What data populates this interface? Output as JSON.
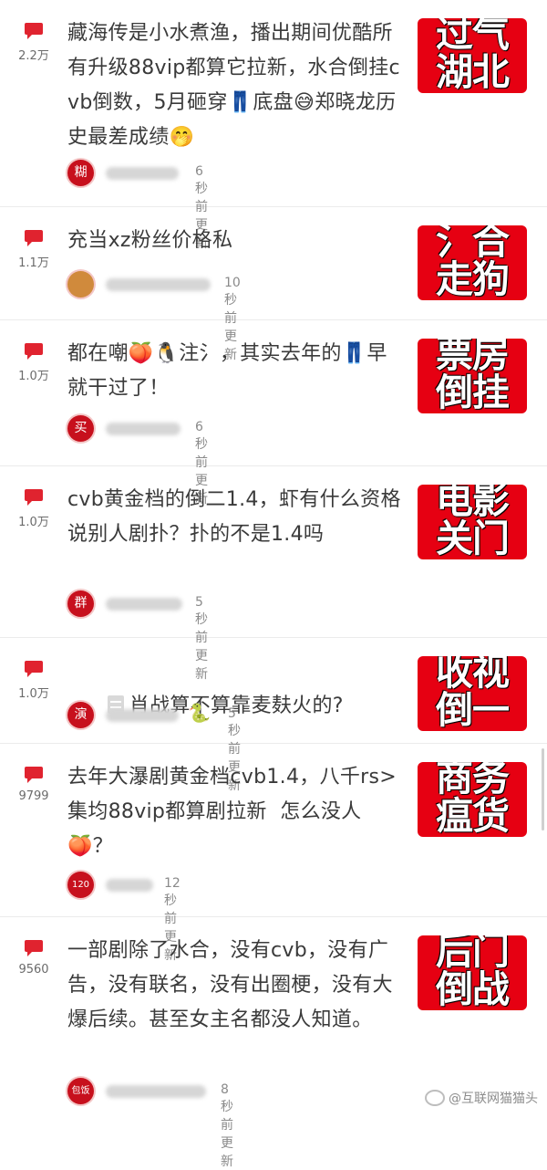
{
  "items": [
    {
      "count": "2.2万",
      "title": "藏海传是小水煮渔，播出期间优酷所有升级88vip都算它拉新，水合倒挂cvb倒数，5月砸穿👖底盘😅郑晓龙历史最差成绩🤭",
      "avatar": "糊",
      "time": "6秒前更新",
      "thumb": [
        "过气",
        "湖北"
      ]
    },
    {
      "count": "1.1万",
      "title": "充当xz粉丝价格私",
      "avatar": "",
      "time": "10秒前更新",
      "thumb": [
        "氵合",
        "走狗"
      ]
    },
    {
      "count": "1.0万",
      "title": "都在嘲🍑🐧注氵，其实去年的👖早就干过了！",
      "avatar": "买",
      "time": "6秒前更新",
      "thumb": [
        "票房",
        "倒挂"
      ]
    },
    {
      "count": "1.0万",
      "title": "cvb黄金档的倒二1.4，虾有什么资格说别人剧扑？扑的不是1.4吗",
      "avatar": "群",
      "time": "5秒前更新",
      "thumb": [
        "电影",
        "关门"
      ]
    },
    {
      "count": "1.0万",
      "title": "肖战算不算靠麦麸火的?",
      "avatar": "演",
      "badge": "🐍",
      "time": "5秒前更新",
      "thumb": [
        "收视",
        "倒一"
      ]
    },
    {
      "count": "9799",
      "title": "去年大瀑剧黄金档cvb1.4，八千rs>集均88vip都算剧拉新  怎么没人🍑？",
      "avatar": "120",
      "time": "12秒前更新",
      "thumb": [
        "商务",
        "瘟货"
      ]
    },
    {
      "count": "9560",
      "title": "一部剧除了水合，没有cvb，没有广告，没有联名，没有出圈梗，没有大爆后续。甚至女主名都没人知道。",
      "avatar": "包饭",
      "time": "8秒前更新",
      "thumb": [
        "后门",
        "倒战"
      ]
    }
  ],
  "watermark": "@互联网猫猫头",
  "colors": {
    "accent": "#e60012",
    "icon": "#e0232f",
    "text": "#3a3a3a",
    "meta": "#8a8a8a"
  },
  "icons": {
    "comment": "speech-bubble-icon",
    "doc": "document-icon"
  }
}
